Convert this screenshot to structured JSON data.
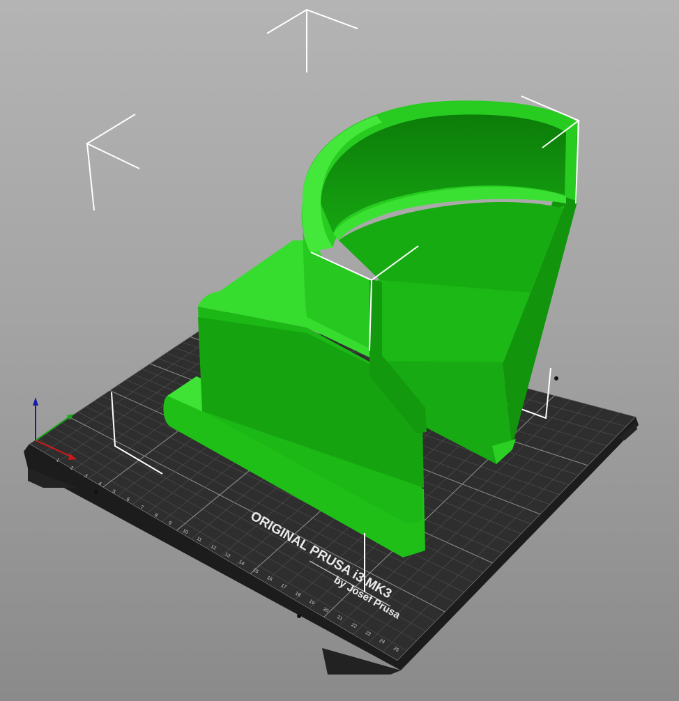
{
  "colors": {
    "background_top": "#b4b4b4",
    "background_bottom": "#8a8a8a",
    "bed": "#2e2e2e",
    "bed_grid": "#5c5c5c",
    "model_light": "#22cc1c",
    "model_mid": "#19b013",
    "model_dark": "#0e8a0a",
    "bounding_box": "#ffffff",
    "axis_x": "#d01818",
    "axis_y": "#1aa81a",
    "axis_z": "#1a1aa8"
  },
  "bed": {
    "brand_line": "ORIGINAL PRUSA i3  MK3",
    "maker_line": "by Josef Prusa",
    "tick_labels": [
      "1",
      "2",
      "3",
      "4",
      "5",
      "6",
      "7",
      "8",
      "9",
      "10",
      "11",
      "12",
      "13",
      "14",
      "15",
      "16",
      "17",
      "18",
      "19",
      "20",
      "21",
      "22",
      "23",
      "24",
      "25"
    ]
  },
  "scene": {
    "model_icon": "printed-part-model",
    "axes_icon": "xyz-axes-gizmo"
  }
}
